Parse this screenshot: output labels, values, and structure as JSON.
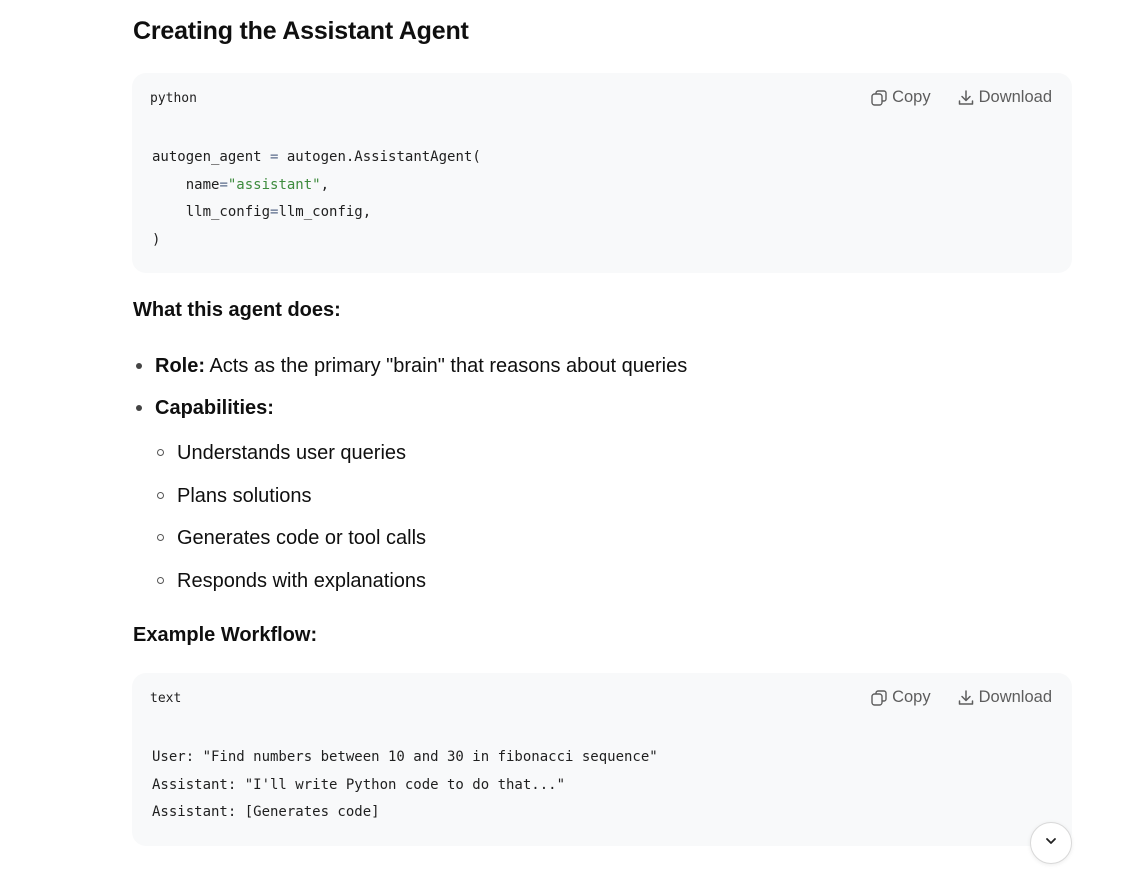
{
  "section_title": "Creating the Assistant Agent",
  "code_blocks": [
    {
      "language": "python",
      "copy_label": "Copy",
      "download_label": "Download",
      "lines": [
        "autogen_agent = autogen.AssistantAgent(",
        "    name=\"assistant\",",
        "    llm_config=llm_config,",
        ")"
      ]
    },
    {
      "language": "text",
      "copy_label": "Copy",
      "download_label": "Download",
      "lines": [
        "User: \"Find numbers between 10 and 30 in fibonacci sequence\"",
        "Assistant: \"I'll write Python code to do that...\"",
        "Assistant: [Generates code]"
      ]
    }
  ],
  "what_heading": "What this agent does:",
  "role": {
    "label": "Role:",
    "text": " Acts as the primary \"brain\" that reasons about queries"
  },
  "capabilities": {
    "label": "Capabilities:",
    "items": [
      "Understands user queries",
      "Plans solutions",
      "Generates code or tool calls",
      "Responds with explanations"
    ]
  },
  "example_heading": "Example Workflow:",
  "icons": {
    "copy": "copy-icon",
    "download": "download-icon",
    "scroll": "chevron-down-icon"
  }
}
